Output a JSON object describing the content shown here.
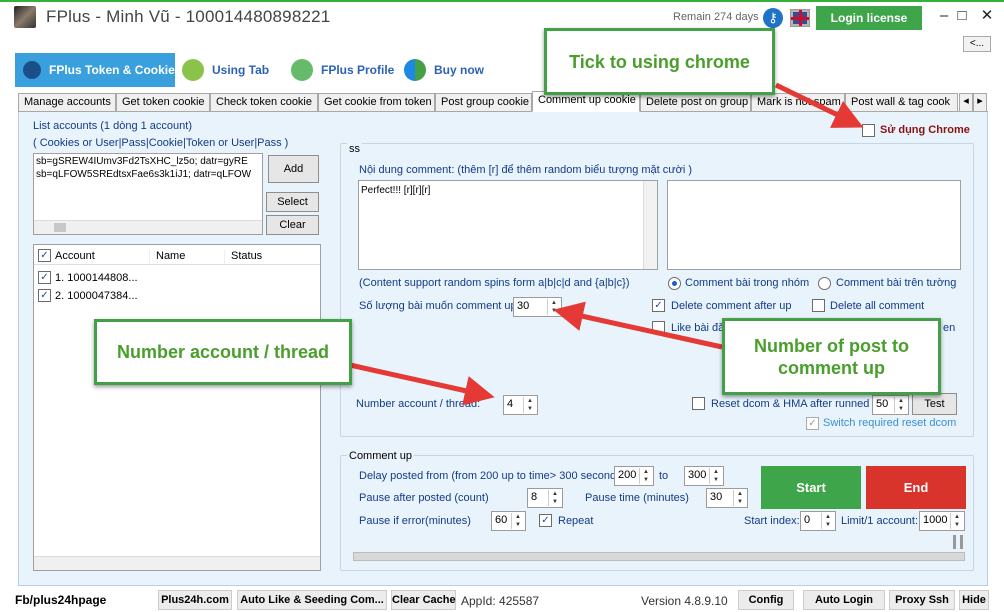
{
  "window": {
    "title": "FPlus - Minh Vũ - 100014480898221",
    "remain": "Remain 274 days",
    "login_license": "Login license",
    "minimize": "–",
    "maximize": "□",
    "close": "✕",
    "back": "<..."
  },
  "main_tabs": [
    {
      "label": "FPlus Token & Cookie"
    },
    {
      "label": "Using Tab"
    },
    {
      "label": "FPlus Profile"
    },
    {
      "label": "Buy now"
    }
  ],
  "sub_tabs": [
    {
      "label": "Manage accounts"
    },
    {
      "label": "Get token cookie"
    },
    {
      "label": "Check token cookie"
    },
    {
      "label": "Get cookie from token"
    },
    {
      "label": "Post group cookie"
    },
    {
      "label": "Comment up cookie"
    },
    {
      "label": "Delete post on group"
    },
    {
      "label": "Mark is not spam"
    },
    {
      "label": "Post wall & tag cook"
    }
  ],
  "left": {
    "list_title": "List accounts (1 dòng 1 account)",
    "list_format": "( Cookies or User|Pass|Cookie|Token or User|Pass )",
    "textarea_lines": [
      "sb=gSREW4IUmv3Fd2TsXHC_lz5o; datr=gyRE",
      "sb=qLFOW5SREdtsxFae6s3k1iJ1; datr=qLFOW"
    ],
    "add": "Add",
    "select": "Select",
    "clear": "Clear",
    "columns": [
      "Account",
      "Name",
      "Status"
    ],
    "rows": [
      {
        "account": "1. 1000144808...",
        "name": "",
        "status": ""
      },
      {
        "account": "2. 1000047384...",
        "name": "",
        "status": ""
      }
    ]
  },
  "settings": {
    "group_label": "ss",
    "use_chrome": "Sử dụng Chrome",
    "comment_label": "Nội dung comment: (thêm [r] để thêm random biểu tượng mặt cười )",
    "comment_text": "Perfect!!! [r][r][r]",
    "spin_note": "(Content support random spins form a|b|c|d and {a|b|c})",
    "radio_group": "Comment bài trong nhóm",
    "radio_wall": "Comment bài trên tường",
    "post_count_label": "Số lượng bài muốn comment up",
    "post_count": "30",
    "delete_after": "Delete comment after up",
    "delete_all": "Delete all comment",
    "like_post": "Like bài đă",
    "trailing_text": "en",
    "thread_label": "Number account / thread:",
    "thread_value": "4",
    "reset_dcom": "Reset dcom & HMA after runned",
    "reset_value": "50",
    "test": "Test",
    "switch_reset": "Switch required reset dcom"
  },
  "comment_up": {
    "group_label": "Comment up",
    "delay_label": "Delay posted from (from 200 up to time> 300 seconds)",
    "delay_from": "200",
    "to": "to",
    "delay_to": "300",
    "pause_after_label": "Pause after posted (count)",
    "pause_after": "8",
    "pause_time_label": "Pause time (minutes)",
    "pause_time": "30",
    "pause_error_label": "Pause if error(minutes)",
    "pause_error": "60",
    "repeat": "Repeat",
    "start_index_label": "Start index:",
    "start_index": "0",
    "limit_label": "Limit/1 account:",
    "limit": "1000",
    "start": "Start",
    "end": "End"
  },
  "callouts": {
    "chrome": "Tick to using chrome",
    "thread": "Number account / thread",
    "post": "Number of post to comment up"
  },
  "status": {
    "fb": "Fb/plus24hpage",
    "plus24h": "Plus24h.com",
    "autolike": "Auto Like & Seeding Com...",
    "clearcache": "Clear Cache",
    "appid": "AppId: 425587",
    "version": "Version 4.8.9.10",
    "config": "Config",
    "autologin": "Auto Login",
    "proxy": "Proxy Ssh",
    "hide": "Hide"
  },
  "colors": {
    "accent_green": "#43a047",
    "start": "#3ea54a",
    "end": "#d9342b",
    "tab_blue": "#3aa0dd",
    "arrow": "#e53935"
  },
  "icons": [
    "app-icon",
    "key-icon",
    "uk-flag-icon",
    "token-icon",
    "link-icon",
    "people-icon",
    "refresh-icon"
  ]
}
